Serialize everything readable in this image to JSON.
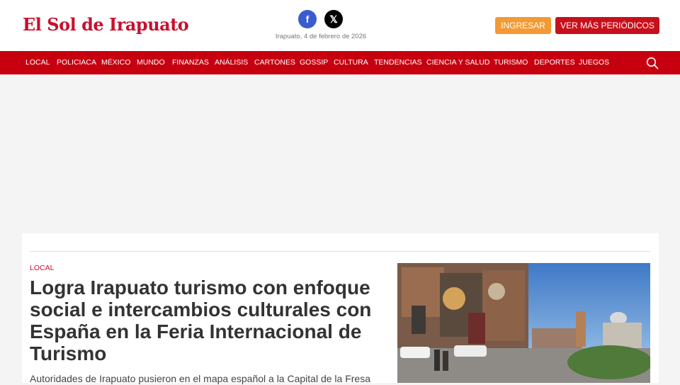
{
  "header": {
    "logo_text": "El Sol de Irapuato",
    "date": "Irapuato, 4 de febrero de 2026",
    "facebook_icon": "f",
    "x_icon": "𝕏",
    "login_label": "INGRESAR",
    "more_papers_label": "VER MÁS PERIÓDICOS"
  },
  "nav": {
    "items": [
      "LOCAL",
      "POLICIACA",
      "MÉXICO",
      "MUNDO",
      "FINANZAS",
      "ANÁLISIS",
      "CARTONES",
      "GOSSIP",
      "CULTURA",
      "TENDENCIAS",
      "CIENCIA Y SALUD",
      "TURISMO",
      "DEPORTES",
      "JUEGOS"
    ],
    "search_icon": "search-icon"
  },
  "article": {
    "section": "LOCAL",
    "headline": "Logra Irapuato turismo con enfoque social e intercambios culturales con España en la Feria Internacional de Turismo",
    "summary": "Autoridades de Irapuato pusieron en el mapa español a la Capital de la Fresa"
  },
  "colors": {
    "brand_red": "#c7000f",
    "orange": "#f39a34",
    "facebook": "#3b5ccf"
  }
}
